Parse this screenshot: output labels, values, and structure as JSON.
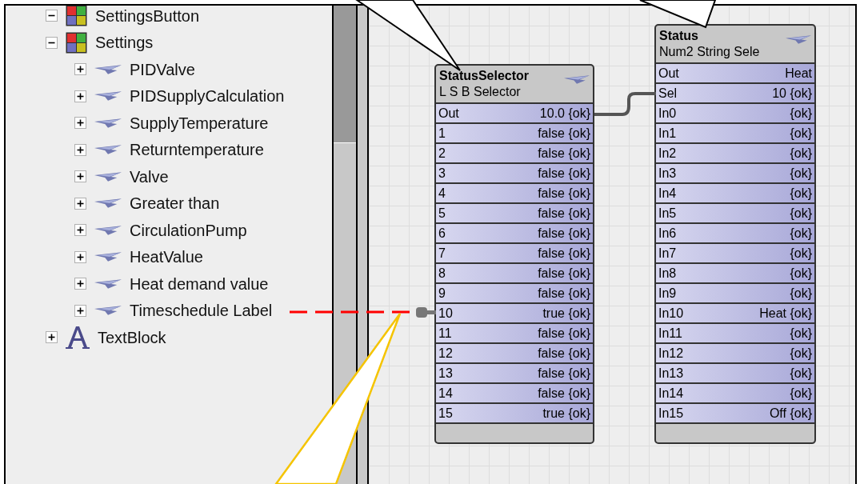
{
  "tree": [
    {
      "label": "SettingsButton",
      "kind": "puzzle",
      "expanded": true
    },
    {
      "label": "Settings",
      "kind": "puzzle",
      "expanded": true,
      "children": [
        {
          "label": "PIDValve",
          "kind": "wing",
          "expanded": false
        },
        {
          "label": "PIDSupplyCalculation",
          "kind": "wing",
          "expanded": false
        },
        {
          "label": "SupplyTemperature",
          "kind": "wing",
          "expanded": false
        },
        {
          "label": "Returntemperature",
          "kind": "wing",
          "expanded": false
        },
        {
          "label": "Valve",
          "kind": "wing",
          "expanded": false
        },
        {
          "label": "Greater than",
          "kind": "wing",
          "expanded": false
        },
        {
          "label": "CirculationPump",
          "kind": "wing",
          "expanded": false
        },
        {
          "label": "HeatValue",
          "kind": "wing",
          "expanded": false
        },
        {
          "label": "Heat demand value",
          "kind": "wing",
          "expanded": false
        },
        {
          "label": "Timeschedule Label",
          "kind": "wing",
          "expanded": false
        }
      ]
    },
    {
      "label": "TextBlock",
      "kind": "text",
      "expanded": false
    }
  ],
  "blocks": [
    {
      "title": "StatusSelector",
      "subtitle": "L S B Selector",
      "slots": [
        {
          "name": "Out",
          "value": "10.0 {ok}"
        },
        {
          "name": "1",
          "value": "false {ok}"
        },
        {
          "name": "2",
          "value": "false {ok}"
        },
        {
          "name": "3",
          "value": "false {ok}"
        },
        {
          "name": "4",
          "value": "false {ok}"
        },
        {
          "name": "5",
          "value": "false {ok}"
        },
        {
          "name": "6",
          "value": "false {ok}"
        },
        {
          "name": "7",
          "value": "false {ok}"
        },
        {
          "name": "8",
          "value": "false {ok}"
        },
        {
          "name": "9",
          "value": "false {ok}"
        },
        {
          "name": "10",
          "value": "true {ok}"
        },
        {
          "name": "11",
          "value": "false {ok}"
        },
        {
          "name": "12",
          "value": "false {ok}"
        },
        {
          "name": "13",
          "value": "false {ok}"
        },
        {
          "name": "14",
          "value": "false {ok}"
        },
        {
          "name": "15",
          "value": "true {ok}"
        }
      ]
    },
    {
      "title": "Status",
      "subtitle": "Num2 String Sele",
      "slots": [
        {
          "name": "Out",
          "value": "Heat"
        },
        {
          "name": "Sel",
          "value": "10 {ok}"
        },
        {
          "name": "In0",
          "value": "{ok}"
        },
        {
          "name": "In1",
          "value": "{ok}"
        },
        {
          "name": "In2",
          "value": "{ok}"
        },
        {
          "name": "In3",
          "value": "{ok}"
        },
        {
          "name": "In4",
          "value": "{ok}"
        },
        {
          "name": "In5",
          "value": "{ok}"
        },
        {
          "name": "In6",
          "value": "{ok}"
        },
        {
          "name": "In7",
          "value": "{ok}"
        },
        {
          "name": "In8",
          "value": "{ok}"
        },
        {
          "name": "In9",
          "value": "{ok}"
        },
        {
          "name": "In10",
          "value": "Heat {ok}"
        },
        {
          "name": "In11",
          "value": "{ok}"
        },
        {
          "name": "In12",
          "value": "{ok}"
        },
        {
          "name": "In13",
          "value": "{ok}"
        },
        {
          "name": "In14",
          "value": "{ok}"
        },
        {
          "name": "In15",
          "value": "Off {ok}"
        }
      ]
    }
  ]
}
